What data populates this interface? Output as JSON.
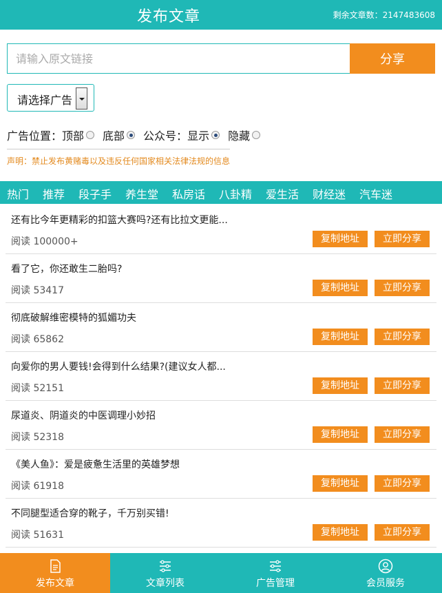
{
  "header": {
    "title": "发布文章",
    "remaining": "剩余文章数：2147483608"
  },
  "form": {
    "url_placeholder": "请输入原文链接",
    "share_label": "分享",
    "ad_select_value": "请选择广告",
    "ad_position_label": "广告位置：",
    "top_label": "顶部",
    "bottom_label": "底部",
    "account_label": "公众号：",
    "show_label": "显示",
    "hide_label": "隐藏",
    "notice": "声明：禁止发布黄赌毒以及违反任何国家相关法律法规的信息"
  },
  "tabs": [
    "热门",
    "推荐",
    "段子手",
    "养生堂",
    "私房话",
    "八卦精",
    "爱生活",
    "财经迷",
    "汽车迷"
  ],
  "articles": [
    {
      "title": "还有比今年更精彩的扣篮大赛吗?还有比拉文更能...",
      "reads": "阅读 100000+"
    },
    {
      "title": "看了它，你还敢生二胎吗?",
      "reads": "阅读 53417"
    },
    {
      "title": "彻底破解维密模特的狐媚功夫",
      "reads": "阅读 65862"
    },
    {
      "title": "向爱你的男人要钱!会得到什么结果?(建议女人都...",
      "reads": "阅读 52151"
    },
    {
      "title": "尿道炎、阴道炎的中医调理小妙招",
      "reads": "阅读 52318"
    },
    {
      "title": "《美人鱼》：爱是疲惫生活里的英雄梦想",
      "reads": "阅读 61918"
    },
    {
      "title": "不同腿型适合穿的靴子，千万别买错!",
      "reads": "阅读 51631"
    }
  ],
  "buttons": {
    "copy": "复制地址",
    "share_now": "立即分享"
  },
  "footer": [
    "发布文章",
    "文章列表",
    "广告管理",
    "会员服务"
  ],
  "colors": {
    "accent": "#1fb8b6",
    "orange": "#f28d1e"
  }
}
